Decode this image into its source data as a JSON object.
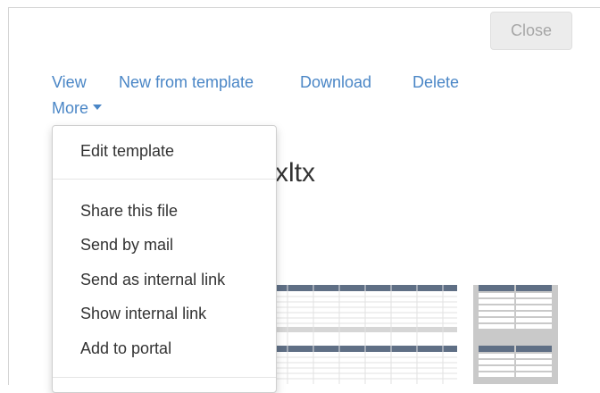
{
  "header": {
    "close_label": "Close"
  },
  "actions": {
    "view": "View",
    "new_from_template": "New from template",
    "download": "Download",
    "delete": "Delete",
    "more": "More"
  },
  "file": {
    "title_visible": "xltx"
  },
  "menu": {
    "edit_template": "Edit template",
    "share_file": "Share this file",
    "send_by_mail": "Send by mail",
    "send_internal_link": "Send as internal link",
    "show_internal_link": "Show internal link",
    "add_to_portal": "Add to portal"
  },
  "colors": {
    "link": "#4a86c6",
    "sheet_header": "#5f6f85",
    "sheet_grey": "#c9c9c9"
  }
}
